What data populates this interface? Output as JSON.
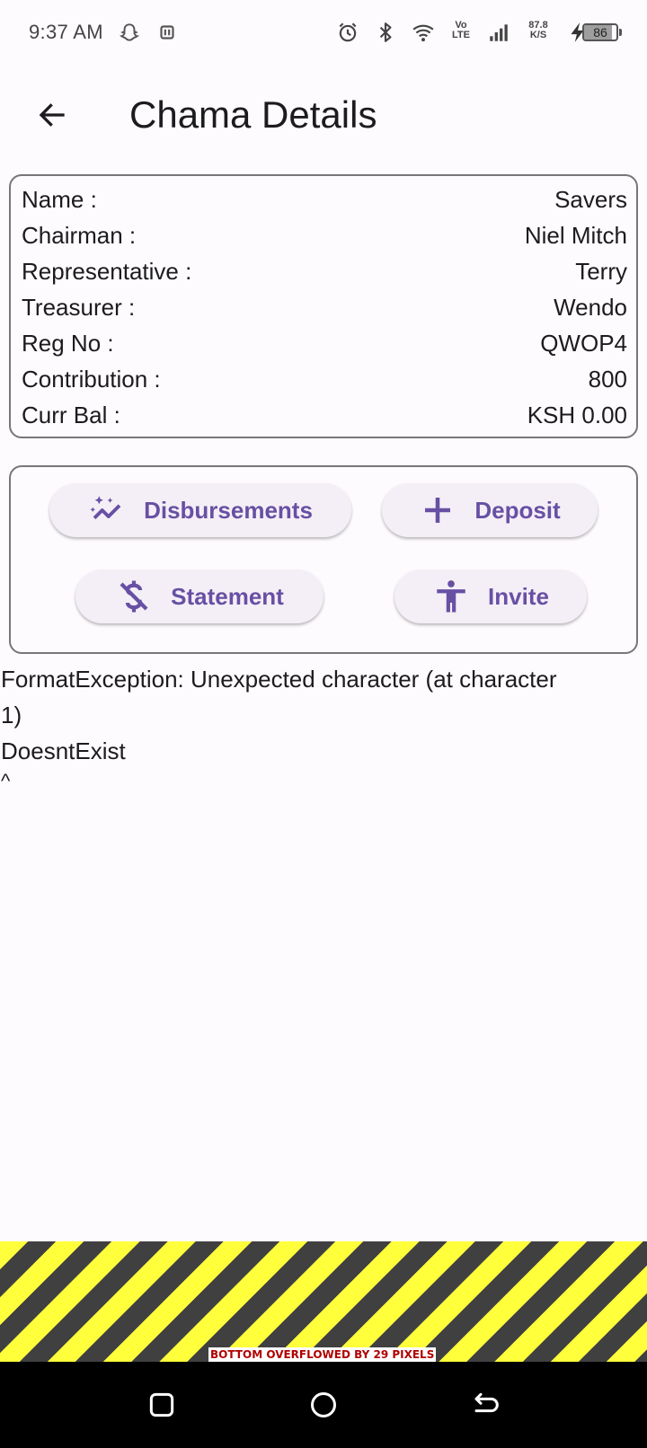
{
  "status_bar": {
    "time": "9:37 AM",
    "network_speed_value": "87.8",
    "network_speed_unit": "K/S",
    "volte_top": "Vo",
    "volte_bottom": "LTE",
    "battery_level": "86",
    "battery_fraction": 0.86,
    "icons": [
      "snapchat-ghost-icon",
      "nfc-icon",
      "alarm-icon",
      "bluetooth-icon",
      "wifi-icon",
      "volte-icon",
      "signal-icon",
      "charging-bolt-icon",
      "battery-icon"
    ]
  },
  "app_bar": {
    "title": "Chama Details",
    "back_icon": "arrow-back-icon"
  },
  "details": {
    "rows": [
      {
        "label": "Name :",
        "value": "Savers"
      },
      {
        "label": "Chairman :",
        "value": "Niel Mitch"
      },
      {
        "label": "Representative :",
        "value": "Terry"
      },
      {
        "label": "Treasurer :",
        "value": "Wendo"
      },
      {
        "label": "Reg No :",
        "value": "QWOP4"
      },
      {
        "label": "Contribution :",
        "value": "800"
      },
      {
        "label": "Curr Bal :",
        "value": "KSH 0.00"
      }
    ]
  },
  "actions": {
    "disbursements": {
      "label": "Disbursements",
      "icon": "auto-graph-icon"
    },
    "deposit": {
      "label": "Deposit",
      "icon": "plus-icon"
    },
    "statement": {
      "label": "Statement",
      "icon": "money-off-icon"
    },
    "invite": {
      "label": "Invite",
      "icon": "accessibility-icon"
    }
  },
  "error": {
    "line1": "FormatException: Unexpected character (at character",
    "line2": "1)",
    "line3": "DoesntExist",
    "line4": "^"
  },
  "overflow": {
    "label": "BOTTOM OVERFLOWED BY 29 PIXELS"
  },
  "colors": {
    "accent": "#6750a4",
    "button_bg": "#f4eff6",
    "background": "#fefbfe",
    "stripe_yellow": "#ffff3b",
    "stripe_dark": "#404040",
    "overflow_text": "#b00000"
  }
}
